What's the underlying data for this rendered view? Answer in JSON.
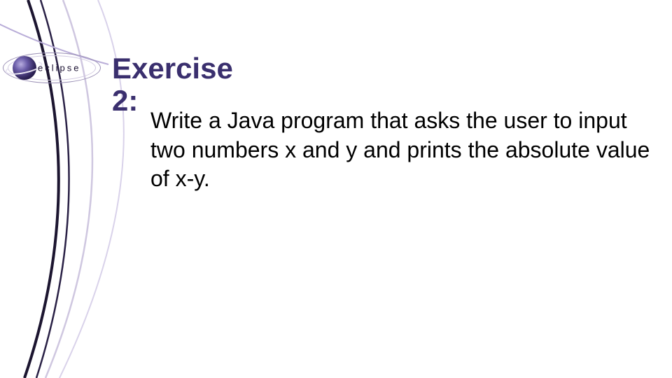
{
  "logo": {
    "text": "eclipse"
  },
  "title": {
    "line1": "Exercise",
    "line2": "2:"
  },
  "body": {
    "text": "Write a Java program that asks the user to input two numbers x and y and prints the absolute value of x-y."
  },
  "colors": {
    "title": "#3a2f6e",
    "curve_dark": "#1c1530",
    "curve_light": "#cfc7e0"
  }
}
